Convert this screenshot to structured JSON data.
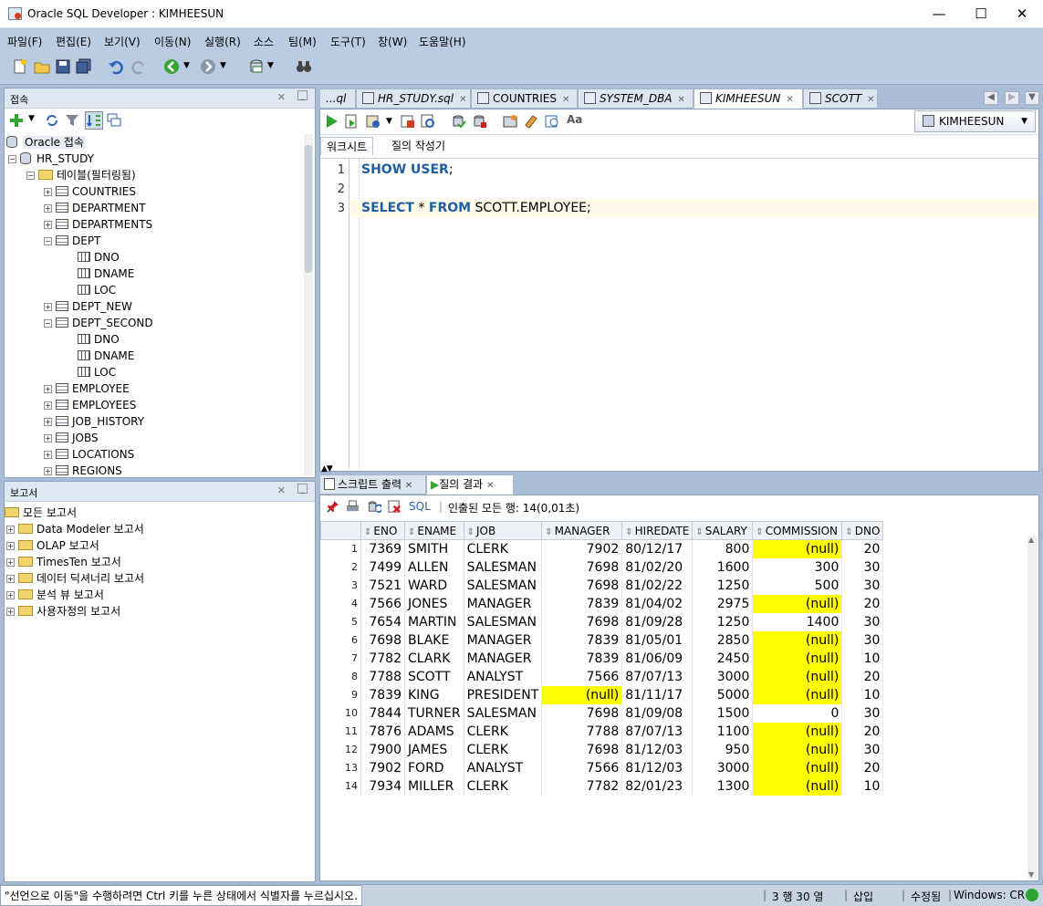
{
  "window": {
    "title": "Oracle SQL Developer : KIMHEESUN",
    "min": "—",
    "max": "☐",
    "close": "✕"
  },
  "menu": [
    "파일(F)",
    "편집(E)",
    "보기(V)",
    "이동(N)",
    "실행(R)",
    "소스",
    "팀(M)",
    "도구(T)",
    "창(W)",
    "도움말(H)"
  ],
  "connections": {
    "title": "접속",
    "root": "Oracle 접속",
    "conn": "HR_STUDY",
    "tables_folder": "테이블(필터링됨)",
    "tables": [
      "COUNTRIES",
      "DEPARTMENT",
      "DEPARTMENTS",
      "DEPT",
      "DNO",
      "DNAME",
      "LOC",
      "DEPT_NEW",
      "DEPT_SECOND",
      "DNO",
      "DNAME",
      "LOC",
      "EMPLOYEE",
      "EMPLOYEES",
      "JOB_HISTORY",
      "JOBS",
      "LOCATIONS",
      "REGIONS"
    ]
  },
  "reports": {
    "title": "보고서",
    "root": "모든 보고서",
    "items": [
      "Data Modeler 보고서",
      "OLAP 보고서",
      "TimesTen 보고서",
      "데이터 딕셔너리 보고서",
      "분석 뷰 보고서",
      "사용자정의 보고서"
    ]
  },
  "editor_tabs": [
    "...ql",
    "HR_STUDY.sql",
    "COUNTRIES",
    "SYSTEM_DBA",
    "KIMHEESUN",
    "SCOTT"
  ],
  "connection_selector": "KIMHEESUN",
  "subtabs": {
    "worksheet": "워크시트",
    "query_builder": "질의 작성기"
  },
  "code": {
    "line_numbers": [
      "1",
      "2",
      "3"
    ],
    "line1_kw": "SHOW USER",
    "line1_end": ";",
    "line3_kw1": "SELECT",
    "line3_star": " * ",
    "line3_kw2": "FROM",
    "line3_rest": " SCOTT.EMPLOYEE;"
  },
  "output_tabs": {
    "script": "스크립트 출력",
    "query": "질의 결과"
  },
  "results_toolbar": {
    "sql": "SQL",
    "fetched": "인출된 모든 행: 14(0,01초)"
  },
  "grid": {
    "columns": [
      "ENO",
      "ENAME",
      "JOB",
      "MANAGER",
      "HIREDATE",
      "SALARY",
      "COMMISSION",
      "DNO"
    ],
    "rows": [
      [
        "1",
        "7369",
        "SMITH",
        "CLERK",
        "7902",
        "80/12/17",
        "800",
        "(null)",
        "20"
      ],
      [
        "2",
        "7499",
        "ALLEN",
        "SALESMAN",
        "7698",
        "81/02/20",
        "1600",
        "300",
        "30"
      ],
      [
        "3",
        "7521",
        "WARD",
        "SALESMAN",
        "7698",
        "81/02/22",
        "1250",
        "500",
        "30"
      ],
      [
        "4",
        "7566",
        "JONES",
        "MANAGER",
        "7839",
        "81/04/02",
        "2975",
        "(null)",
        "20"
      ],
      [
        "5",
        "7654",
        "MARTIN",
        "SALESMAN",
        "7698",
        "81/09/28",
        "1250",
        "1400",
        "30"
      ],
      [
        "6",
        "7698",
        "BLAKE",
        "MANAGER",
        "7839",
        "81/05/01",
        "2850",
        "(null)",
        "30"
      ],
      [
        "7",
        "7782",
        "CLARK",
        "MANAGER",
        "7839",
        "81/06/09",
        "2450",
        "(null)",
        "10"
      ],
      [
        "8",
        "7788",
        "SCOTT",
        "ANALYST",
        "7566",
        "87/07/13",
        "3000",
        "(null)",
        "20"
      ],
      [
        "9",
        "7839",
        "KING",
        "PRESIDENT",
        "(null)",
        "81/11/17",
        "5000",
        "(null)",
        "10"
      ],
      [
        "10",
        "7844",
        "TURNER",
        "SALESMAN",
        "7698",
        "81/09/08",
        "1500",
        "0",
        "30"
      ],
      [
        "11",
        "7876",
        "ADAMS",
        "CLERK",
        "7788",
        "87/07/13",
        "1100",
        "(null)",
        "20"
      ],
      [
        "12",
        "7900",
        "JAMES",
        "CLERK",
        "7698",
        "81/12/03",
        "950",
        "(null)",
        "30"
      ],
      [
        "13",
        "7902",
        "FORD",
        "ANALYST",
        "7566",
        "81/12/03",
        "3000",
        "(null)",
        "20"
      ],
      [
        "14",
        "7934",
        "MILLER",
        "CLERK",
        "7782",
        "82/01/23",
        "1300",
        "(null)",
        "10"
      ]
    ]
  },
  "status": {
    "message": "\"선언으로 이동\"을 수행하려면 Ctrl 키를 누른 상태에서 식별자를 누르십시오.",
    "position": "3 행 30 열",
    "mode": "삽입",
    "modified": "수정됨",
    "platform": "Windows: CR"
  },
  "colors": {
    "null_highlight": "#ffff00",
    "keyword": "#1f5fa0",
    "frame": "#a9bdd6"
  }
}
